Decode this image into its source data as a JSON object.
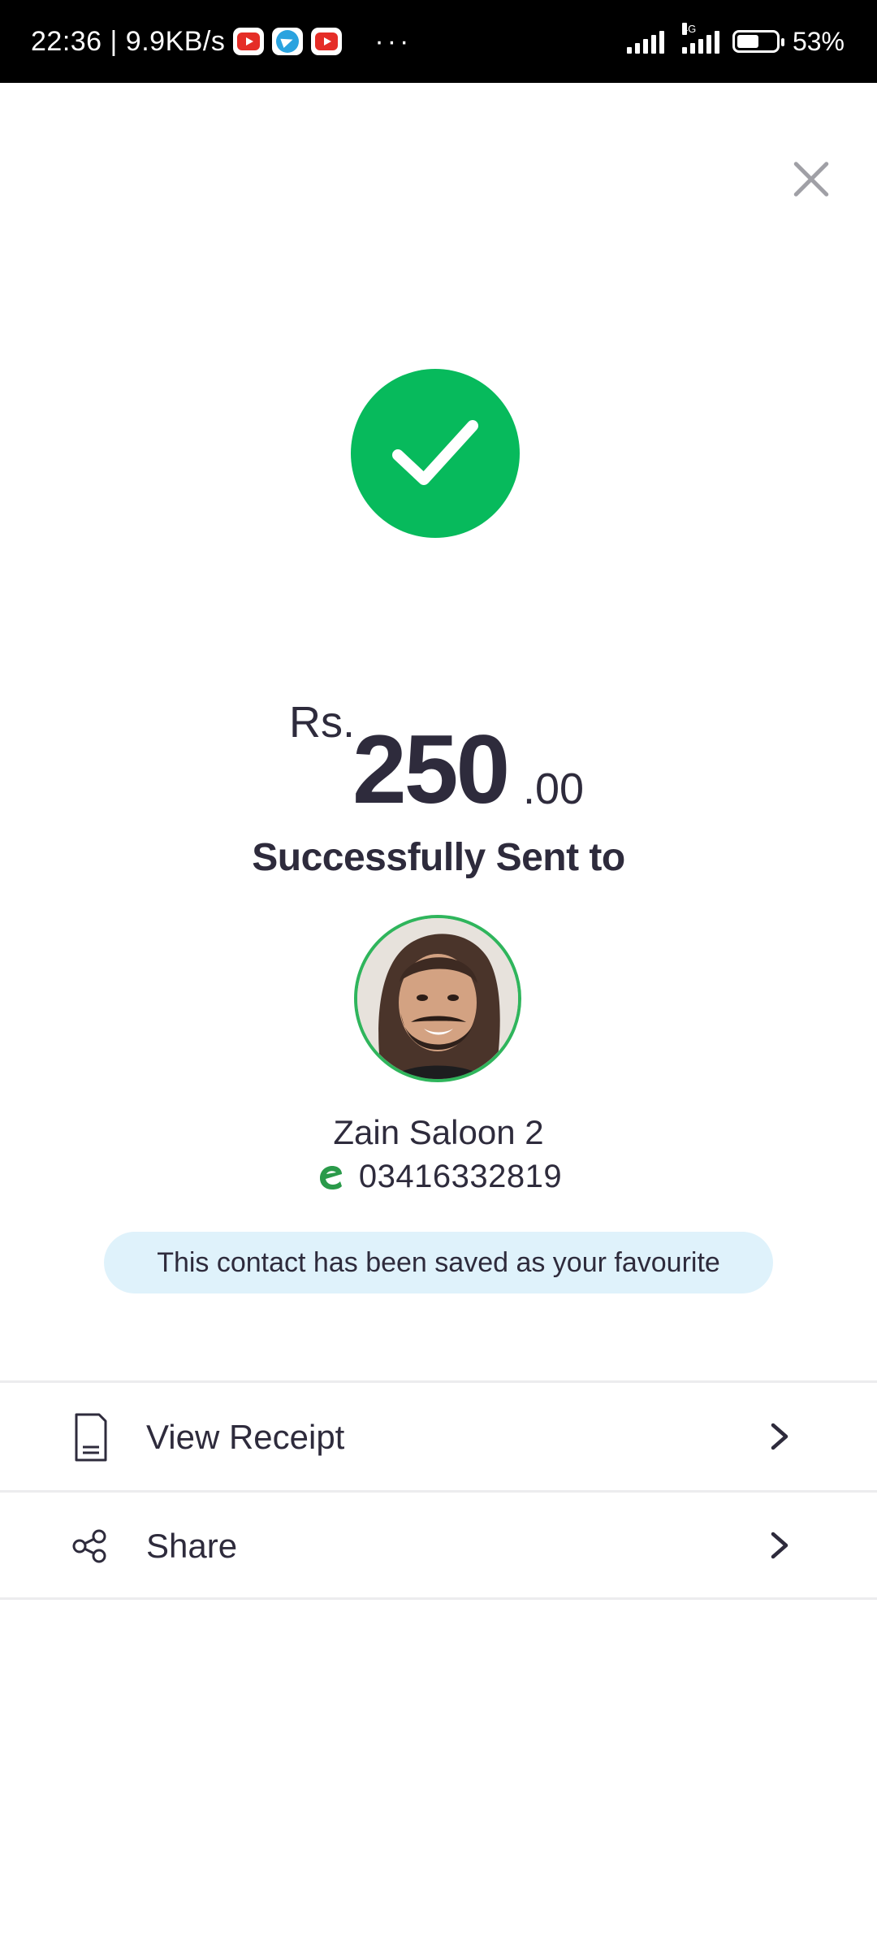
{
  "status_bar": {
    "time": "22:36 | 9.9KB/s",
    "more": "···",
    "network_label": "4G",
    "battery": "53%",
    "battery_level": 0.53
  },
  "close": {
    "icon": "close-icon"
  },
  "success": {
    "icon": "check-icon",
    "color": "#07ba5c",
    "currency": "Rs.",
    "amount": "250",
    "decimals": ".00",
    "title": "Successfully Sent to"
  },
  "recipient": {
    "name": "Zain Saloon 2",
    "phone": "03416332819",
    "wallet_icon": "easypaisa-icon",
    "favourite_notice": "This contact has been saved as your favourite"
  },
  "actions": [
    {
      "label": "View Receipt",
      "icon": "receipt-icon"
    },
    {
      "label": "Share",
      "icon": "share-icon"
    }
  ]
}
